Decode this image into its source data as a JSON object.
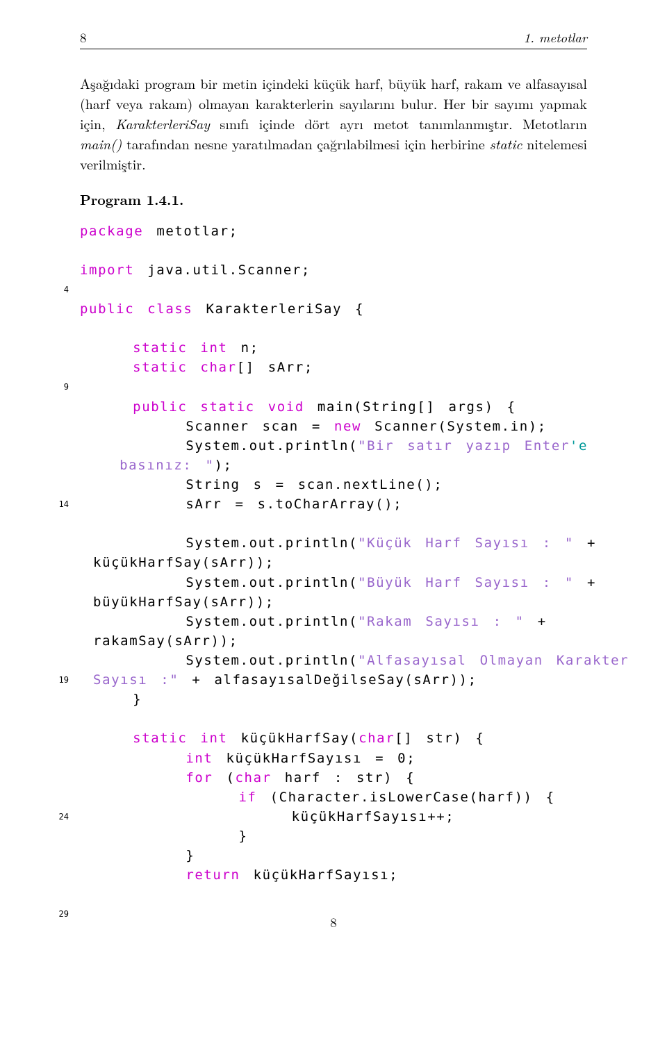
{
  "header": {
    "page_no": "8",
    "running": "1. metotlar"
  },
  "body": {
    "para1a": "Aşağıdaki program bir metin içindeki küçük harf, büyük harf, rakam ve alfasayısal (harf veya rakam) olmayan karakterlerin sayılarını bulur. Her bir sayımı yapmak için, ",
    "para1b": "KarakterleriSay",
    "para1c": " sınıfı içinde dört ayrı metot tanımlanmıştır. Metotların ",
    "para1d": "main()",
    "para1e": " tarafından nesne yaratılmadan çağrılabilmesi için herbirine ",
    "para1f": "static",
    "para1g": " nitelemesi verilmiştir."
  },
  "program_label": "Program 1.4.1.",
  "chart_data": {
    "type": "table",
    "description": "Java source listing",
    "line_numbers": [
      "4",
      "9",
      "14",
      "19",
      "24",
      "29"
    ],
    "line_number_rows": [
      4,
      9,
      14,
      19,
      24,
      29
    ],
    "lines": [
      "package metotlar;",
      "",
      "import java.util.Scanner;",
      "",
      "public class KarakterleriSay {",
      "",
      "    static int n;",
      "    static char[] sArr;",
      "",
      "    public static void main(String[] args) {",
      "        Scanner scan = new Scanner(System.in);",
      "        System.out.println(\"Bir satır yazıp Enter'e basınız: \");",
      "        String s = scan.nextLine();",
      "        sArr = s.toCharArray();",
      "",
      "        System.out.println(\"Küçük Harf Sayısı : \" + küçükHarfSay(sArr));",
      "        System.out.println(\"Büyük Harf Sayısı : \" + büyükHarfSay(sArr));",
      "        System.out.println(\"Rakam Sayısı : \" + rakamSay(sArr));",
      "        System.out.println(\"Alfasayısal Olmayan Karakter Sayısı :\" + alfasayısalDeğilseSay(sArr));",
      "    }",
      "",
      "    static int küçükHarfSay(char[] str) {",
      "        int küçükHarfSayısı = 0;",
      "        for (char harf : str) {",
      "            if (Character.isLowerCase(harf)) {",
      "                küçükHarfSayısı++;",
      "            }",
      "        }",
      "        return küçükHarfSayısı;"
    ]
  },
  "code_tokens": {
    "l1": {
      "k1": "package",
      "t1": " metotlar;"
    },
    "l3a": "import",
    "l3b": " java.util.Scanner;",
    "l5a": "public class",
    "l5b": " KarakterleriSay {",
    "l7a": "static int",
    "l7b": " n;",
    "l8a": "static char",
    "l8b": "[] sArr;",
    "l10a": "public static void",
    "l10b": " main(String[] args) {",
    "l11a": "Scanner scan = ",
    "l11b": "new",
    "l11c": " Scanner(System.in);",
    "l12a": "System.out.println(",
    "l12b": "\"Bir satır yazıp Enter",
    "l12c": "'e",
    "l12d": "\n   basınız: \"",
    "l12e": ");",
    "l13": "String s = scan.nextLine();",
    "l14": "sArr = s.toCharArray();",
    "l16a": "System.out.println(",
    "l16b": "\"Küçük Harf Sayısı : \"",
    "l16c": " +\n küçükHarfSay(sArr));",
    "l17a": "System.out.println(",
    "l17b": "\"Büyük Harf Sayısı : \"",
    "l17c": " +\n büyükHarfSay(sArr));",
    "l18a": "System.out.println(",
    "l18b": "\"Rakam Sayısı : \"",
    "l18c": " +\n rakamSay(sArr));",
    "l19a": "System.out.println(",
    "l19b": "\"Alfasayısal Olmayan Karakter\n Sayısı :\"",
    "l19c": " + alfasayısalDeğilseSay(sArr));",
    "l20": "}",
    "l22a": "static int",
    "l22b": " küçükHarfSay(",
    "l22c": "char",
    "l22d": "[] str) {",
    "l23a": "int",
    "l23b": " küçükHarfSayısı = 0;",
    "l24a": "for",
    "l24b": " (",
    "l24c": "char",
    "l24d": " harf : str) {",
    "l25a": "if",
    "l25b": " (Character.isLowerCase(harf)) {",
    "l26": "küçükHarfSayısı++;",
    "l27": "}",
    "l28": "}",
    "l29a": "return",
    "l29b": " küçükHarfSayısı;"
  },
  "foot_page": "8"
}
